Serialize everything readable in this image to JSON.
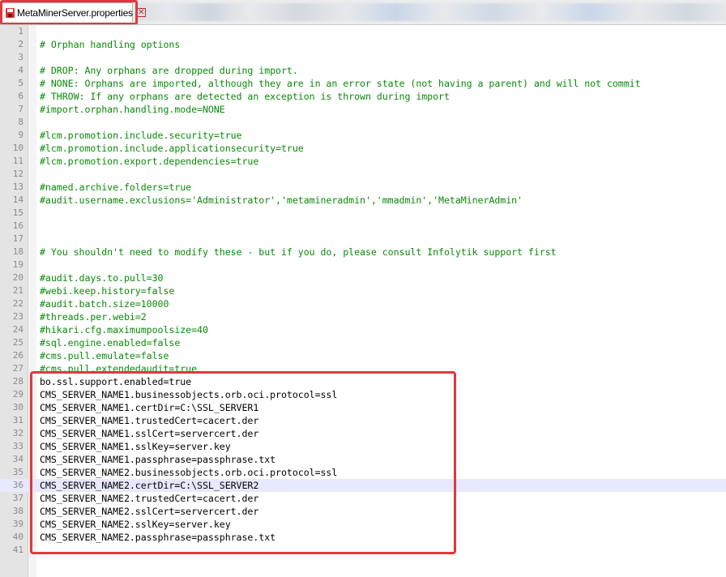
{
  "tab": {
    "filename": "MetaMinerServer.properties",
    "close_symbol": "✕"
  },
  "editor": {
    "current_line": 36,
    "lines": [
      {
        "n": "1",
        "text": "",
        "kind": "plain"
      },
      {
        "n": "2",
        "text": "# Orphan handling options",
        "kind": "comment"
      },
      {
        "n": "3",
        "text": "",
        "kind": "plain"
      },
      {
        "n": "4",
        "text": "# DROP: Any orphans are dropped during import.",
        "kind": "comment"
      },
      {
        "n": "5",
        "text": "# NONE: Orphans are imported, although they are in an error state (not having a parent) and will not commit",
        "kind": "comment"
      },
      {
        "n": "6",
        "text": "# THROW: If any orphans are detected an exception is thrown during import",
        "kind": "comment"
      },
      {
        "n": "7",
        "text": "#import.orphan.handling.mode=NONE",
        "kind": "comment"
      },
      {
        "n": "8",
        "text": "",
        "kind": "plain"
      },
      {
        "n": "9",
        "text": "#lcm.promotion.include.security=true",
        "kind": "comment"
      },
      {
        "n": "10",
        "text": "#lcm.promotion.include.applicationsecurity=true",
        "kind": "comment"
      },
      {
        "n": "11",
        "text": "#lcm.promotion.export.dependencies=true",
        "kind": "comment"
      },
      {
        "n": "12",
        "text": "",
        "kind": "plain"
      },
      {
        "n": "13",
        "text": "#named.archive.folders=true",
        "kind": "comment"
      },
      {
        "n": "14",
        "text": "#audit.username.exclusions='Administrator','metamineradmin','mmadmin','MetaMinerAdmin'",
        "kind": "comment"
      },
      {
        "n": "15",
        "text": "",
        "kind": "plain"
      },
      {
        "n": "16",
        "text": "",
        "kind": "plain"
      },
      {
        "n": "17",
        "text": "",
        "kind": "plain"
      },
      {
        "n": "18",
        "text": "# You shouldn't need to modify these - but if you do, please consult Infolytik support first",
        "kind": "comment"
      },
      {
        "n": "19",
        "text": "",
        "kind": "plain"
      },
      {
        "n": "20",
        "text": "#audit.days.to.pull=30",
        "kind": "comment"
      },
      {
        "n": "21",
        "text": "#webi.keep.history=false",
        "kind": "comment"
      },
      {
        "n": "22",
        "text": "#audit.batch.size=10000",
        "kind": "comment"
      },
      {
        "n": "23",
        "text": "#threads.per.webi=2",
        "kind": "comment"
      },
      {
        "n": "24",
        "text": "#hikari.cfg.maximumpoolsize=40",
        "kind": "comment"
      },
      {
        "n": "25",
        "text": "#sql.engine.enabled=false",
        "kind": "comment"
      },
      {
        "n": "26",
        "text": "#cms.pull.emulate=false",
        "kind": "comment"
      },
      {
        "n": "27",
        "text": "#cms.pull.extendedaudit=true",
        "kind": "comment"
      },
      {
        "n": "28",
        "text": "bo.ssl.support.enabled=true",
        "kind": "plain"
      },
      {
        "n": "29",
        "text": "CMS_SERVER_NAME1.businessobjects.orb.oci.protocol=ssl",
        "kind": "plain"
      },
      {
        "n": "30",
        "text": "CMS_SERVER_NAME1.certDir=C:\\SSL_SERVER1",
        "kind": "plain"
      },
      {
        "n": "31",
        "text": "CMS_SERVER_NAME1.trustedCert=cacert.der",
        "kind": "plain"
      },
      {
        "n": "32",
        "text": "CMS_SERVER_NAME1.sslCert=servercert.der",
        "kind": "plain"
      },
      {
        "n": "33",
        "text": "CMS_SERVER_NAME1.sslKey=server.key",
        "kind": "plain"
      },
      {
        "n": "34",
        "text": "CMS_SERVER_NAME1.passphrase=passphrase.txt",
        "kind": "plain"
      },
      {
        "n": "35",
        "text": "CMS_SERVER_NAME2.businessobjects.orb.oci.protocol=ssl",
        "kind": "plain"
      },
      {
        "n": "36",
        "text": "CMS_SERVER_NAME2.certDir=C:\\SSL_SERVER2",
        "kind": "plain"
      },
      {
        "n": "37",
        "text": "CMS_SERVER_NAME2.trustedCert=cacert.der",
        "kind": "plain"
      },
      {
        "n": "38",
        "text": "CMS_SERVER_NAME2.sslCert=servercert.der",
        "kind": "plain"
      },
      {
        "n": "39",
        "text": "CMS_SERVER_NAME2.sslKey=server.key",
        "kind": "plain"
      },
      {
        "n": "40",
        "text": "CMS_SERVER_NAME2.passphrase=passphrase.txt",
        "kind": "plain"
      },
      {
        "n": "41",
        "text": "",
        "kind": "plain"
      }
    ]
  },
  "colors": {
    "comment": "#0a8a0a",
    "plain": "#000000",
    "highlight_annotation": "#e0383e",
    "current_line_bg": "#e8e8ff"
  }
}
